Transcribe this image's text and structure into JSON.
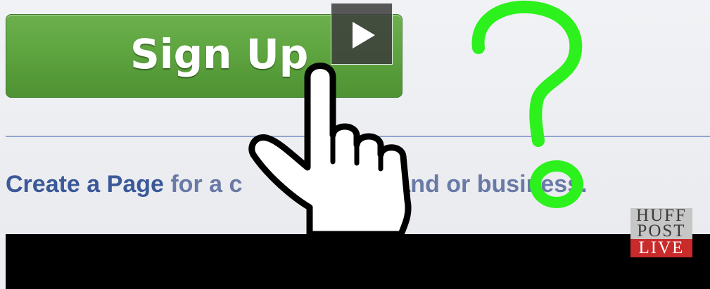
{
  "signup": {
    "label": "Sign Up",
    "color": "#5ea43f"
  },
  "video": {
    "play_icon": "play-icon"
  },
  "create_page": {
    "link": "Create a Page",
    "rest": " for a c",
    "tail": "and or business."
  },
  "overlay": {
    "question_icon": "question-mark-icon",
    "cursor_icon": "pointing-hand-icon",
    "question_color": "#2cf11c"
  },
  "brand": {
    "line1": "HUFF",
    "line2": "POST",
    "line3": "LIVE",
    "live_color": "#c92a2a"
  }
}
